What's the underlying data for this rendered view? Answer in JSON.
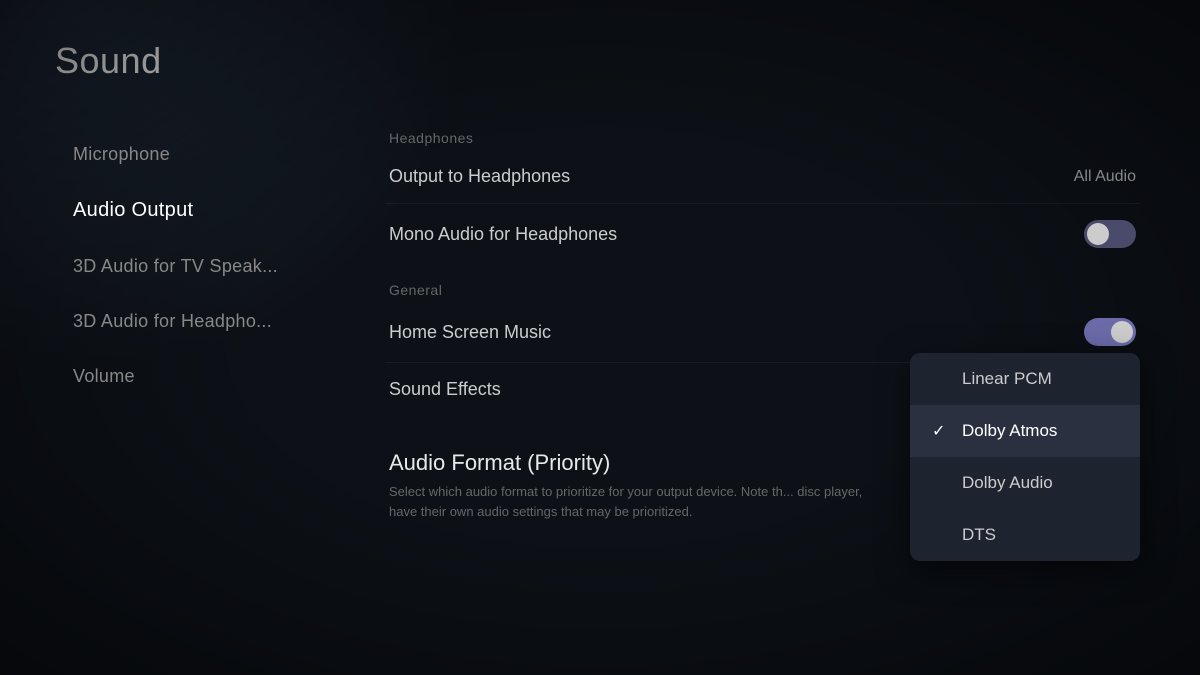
{
  "page": {
    "title": "Sound"
  },
  "sidebar": {
    "items": [
      {
        "id": "microphone",
        "label": "Microphone",
        "active": false
      },
      {
        "id": "audio-output",
        "label": "Audio Output",
        "active": true
      },
      {
        "id": "3d-audio-tv",
        "label": "3D Audio for TV Speak...",
        "active": false
      },
      {
        "id": "3d-audio-headphones",
        "label": "3D Audio for Headpho...",
        "active": false
      },
      {
        "id": "volume",
        "label": "Volume",
        "active": false
      }
    ]
  },
  "main": {
    "sections": [
      {
        "id": "headphones-section",
        "label": "Headphones",
        "rows": [
          {
            "id": "output-to-headphones",
            "label": "Output to Headphones",
            "value": "All Audio",
            "type": "value"
          },
          {
            "id": "mono-audio",
            "label": "Mono Audio for Headphones",
            "value": "",
            "type": "toggle-off"
          }
        ]
      },
      {
        "id": "general-section",
        "label": "General",
        "rows": [
          {
            "id": "home-screen-music",
            "label": "Home Screen Music",
            "value": "",
            "type": "toggle-on"
          },
          {
            "id": "sound-effects",
            "label": "Sound Effects",
            "value": "",
            "type": "dropdown-anchor"
          }
        ]
      }
    ],
    "audio_format": {
      "title": "Audio Format (Priority)",
      "description": "Select which audio format to prioritize for your output device. Note th... disc player, have their own audio settings that may be prioritized."
    },
    "dropdown": {
      "items": [
        {
          "id": "linear-pcm",
          "label": "Linear PCM",
          "selected": false
        },
        {
          "id": "dolby-atmos",
          "label": "Dolby Atmos",
          "selected": true
        },
        {
          "id": "dolby-audio",
          "label": "Dolby Audio",
          "selected": false
        },
        {
          "id": "dts",
          "label": "DTS",
          "selected": false
        }
      ]
    }
  }
}
